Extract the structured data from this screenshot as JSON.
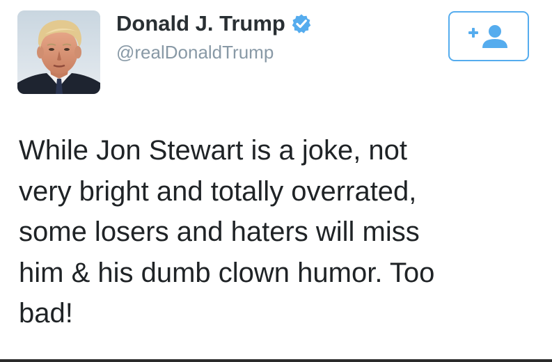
{
  "tweet": {
    "author": {
      "display_name": "Donald J. Trump",
      "handle": "@realDonaldTrump",
      "verified": true,
      "avatar_icon": "profile-photo",
      "verified_icon": "verified-badge-icon"
    },
    "follow_button": {
      "icon": "follow-user-icon"
    },
    "text_lines": [
      "While Jon Stewart is a joke, not",
      "very bright and totally overrated,",
      "some losers and haters will miss",
      "him & his dumb clown humor. Too",
      "bad!"
    ]
  },
  "colors": {
    "accent": "#55acee",
    "name_text": "#292f33",
    "handle_text": "#8899a6",
    "body_text": "#1f2326",
    "background": "#ffffff"
  }
}
